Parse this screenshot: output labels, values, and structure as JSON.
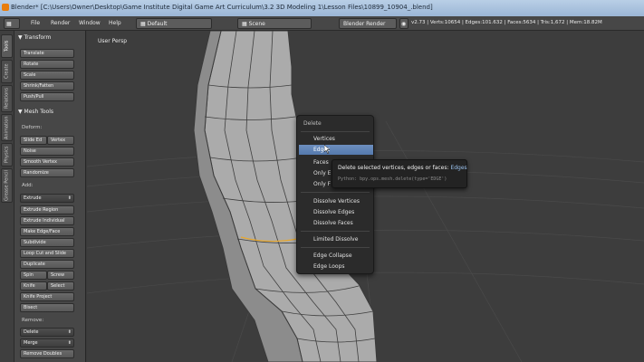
{
  "window": {
    "title": "Blender* [C:\\Users\\Owner\\Desktop\\Game Institute Digital Game Art Curriculum\\3.2 3D Modeling 1\\Lesson Files\\10899_10904_.blend]"
  },
  "menubar": {
    "items": [
      "File",
      "Render",
      "Window",
      "Help"
    ],
    "layout_field": "Default",
    "scene_field": "Scene",
    "render_engine": "Blender Render",
    "stats": "v2.73 | Verts:10654 | Edges:101.632 | Faces:5634 | Tris:1,672 | Mem:18.82M"
  },
  "tabs": [
    "Tools",
    "Create",
    "Relations",
    "Animation",
    "Physics",
    "Grease Pencil"
  ],
  "toolshelf": {
    "transform_header": "▼ Transform",
    "transform_buttons": [
      "Translate",
      "Rotate",
      "Scale",
      "Shrink/Fatten",
      "Push/Pull"
    ],
    "mesh_tools_header": "▼ Mesh Tools",
    "deform_label": "Deform:",
    "deform_pair_1": [
      "Slide Ed",
      "Vertex"
    ],
    "deform_buttons": [
      "Noise",
      "Smooth Vertex",
      "Randomize"
    ],
    "add_label": "Add:",
    "extrude_select": "Extrude",
    "add_buttons": [
      "Extrude Region",
      "Extrude Individual",
      "Make Edge/Face",
      "Subdivide",
      "Loop Cut and Slide",
      "Duplicate"
    ],
    "add_pair_1": [
      "Spin",
      "Screw"
    ],
    "add_pair_2": [
      "Knife",
      "Select"
    ],
    "add_buttons_2": [
      "Knife Project",
      "Bisect"
    ],
    "remove_label": "Remove:",
    "delete_select": "Delete",
    "merge_select": "Merge",
    "remove_doubles": "Remove Doubles"
  },
  "viewport": {
    "label": "User Persp"
  },
  "delete_menu": {
    "title": "Delete",
    "items": [
      "Vertices",
      "Edges",
      "Faces",
      "Only E",
      "Only F",
      "Dissolve Vertices",
      "Dissolve Edges",
      "Dissolve Faces",
      "Limited Dissolve",
      "Edge Collapse",
      "Edge Loops"
    ],
    "highlighted": "Edges"
  },
  "tooltip": {
    "text": "Delete selected vertices, edges or faces:",
    "highlight": "Edges",
    "python": "Python: bpy.ops.mesh.delete(type='EDGE')"
  },
  "colors": {
    "menu_highlight": "#5f85bb",
    "viewport_bg": "#3d3d3d",
    "mesh_face": "#b0b0b0",
    "selected_edge": "#e8a82e"
  }
}
